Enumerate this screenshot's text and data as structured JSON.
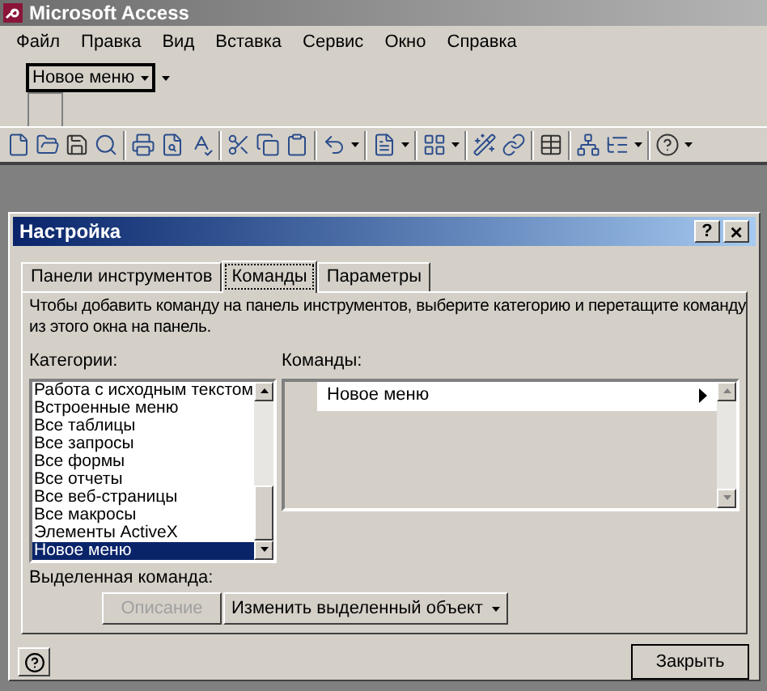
{
  "window": {
    "title": "Microsoft Access"
  },
  "menu": [
    "Файл",
    "Правка",
    "Вид",
    "Вставка",
    "Сервис",
    "Окно",
    "Справка"
  ],
  "custom_toolbar": {
    "menu_label": "Новое меню"
  },
  "dialog": {
    "title": "Настройка",
    "help_glyph": "?",
    "close_glyph": "×",
    "tabs": [
      {
        "label": "Панели инструментов",
        "selected": false
      },
      {
        "label": "Команды",
        "selected": true
      },
      {
        "label": "Параметры",
        "selected": false
      }
    ],
    "instructions": "Чтобы добавить команду на панель инструментов, выберите категорию и перетащите команду из этого окна на панель.",
    "categories_label": "Категории:",
    "categories": [
      {
        "label": "Работа с исходным текстом",
        "selected": false
      },
      {
        "label": "Встроенные меню",
        "selected": false
      },
      {
        "label": "Все таблицы",
        "selected": false
      },
      {
        "label": "Все запросы",
        "selected": false
      },
      {
        "label": "Все формы",
        "selected": false
      },
      {
        "label": "Все отчеты",
        "selected": false
      },
      {
        "label": "Все веб-страницы",
        "selected": false
      },
      {
        "label": "Все макросы",
        "selected": false
      },
      {
        "label": "Элементы ActiveX",
        "selected": false
      },
      {
        "label": "Новое меню",
        "selected": true
      }
    ],
    "commands_label": "Команды:",
    "commands": [
      "Новое меню"
    ],
    "selected_command_label": "Выделенная команда:",
    "description_button": {
      "label": "Описание",
      "disabled": true
    },
    "modify_button": {
      "label": "Изменить выделенный объект"
    },
    "close_button": {
      "label": "Закрыть"
    }
  }
}
